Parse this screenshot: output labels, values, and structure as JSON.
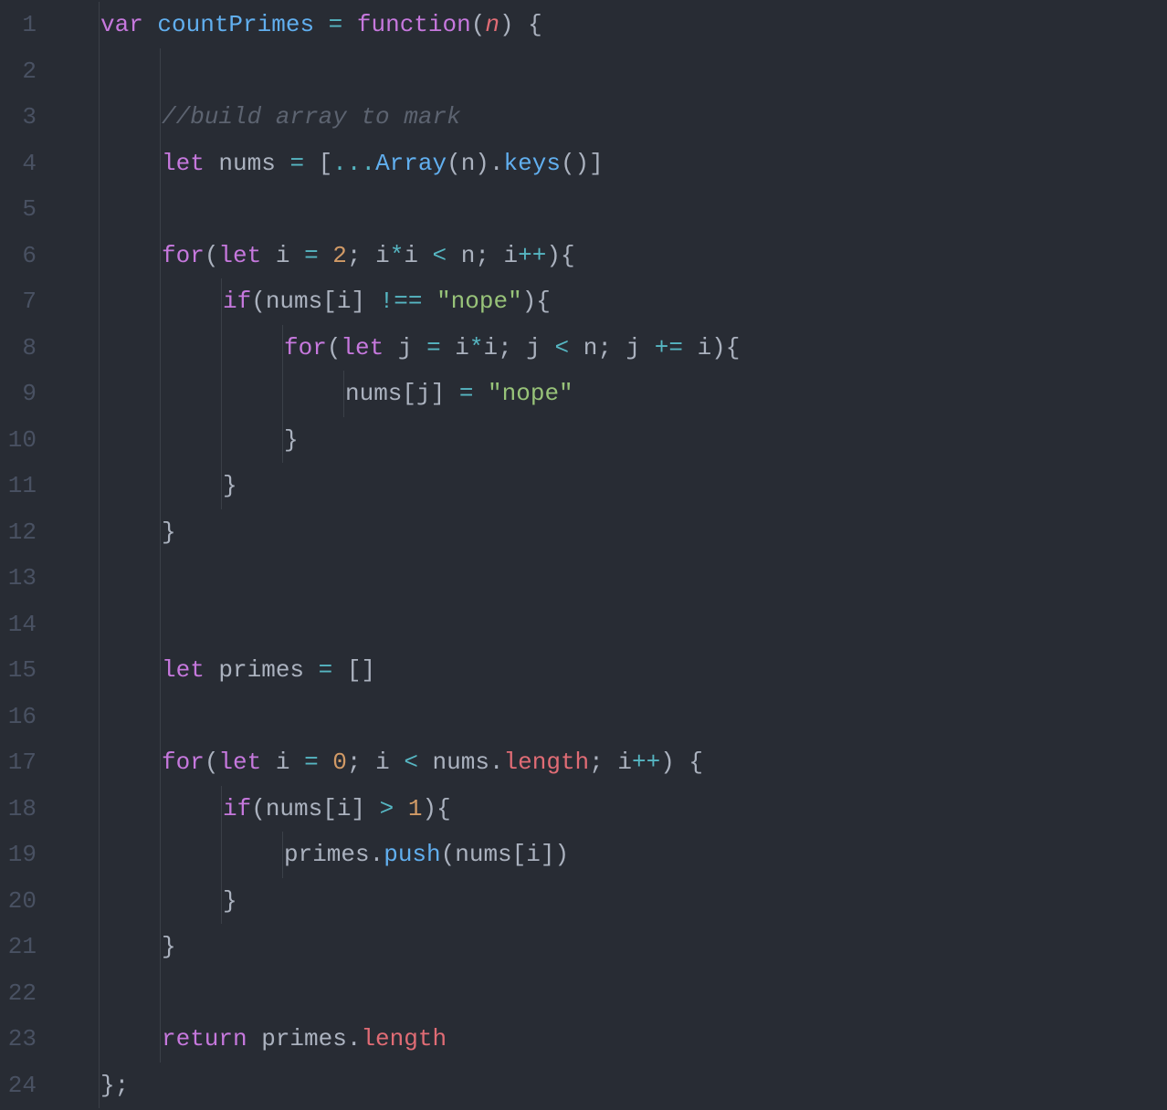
{
  "editor": {
    "language": "javascript",
    "line_count": 24,
    "lines": [
      {
        "num": 1,
        "indent": 1,
        "tokens": [
          {
            "t": "var ",
            "c": "kw"
          },
          {
            "t": "countPrimes",
            "c": "fn"
          },
          {
            "t": " ",
            "c": "pun"
          },
          {
            "t": "=",
            "c": "op"
          },
          {
            "t": " ",
            "c": "pun"
          },
          {
            "t": "function",
            "c": "kw"
          },
          {
            "t": "(",
            "c": "pun"
          },
          {
            "t": "n",
            "c": "param"
          },
          {
            "t": ") {",
            "c": "pun"
          }
        ]
      },
      {
        "num": 2,
        "indent": 2,
        "tokens": []
      },
      {
        "num": 3,
        "indent": 2,
        "tokens": [
          {
            "t": "//build array to mark",
            "c": "com"
          }
        ]
      },
      {
        "num": 4,
        "indent": 2,
        "tokens": [
          {
            "t": "let ",
            "c": "kw"
          },
          {
            "t": "nums ",
            "c": "id"
          },
          {
            "t": "=",
            "c": "op"
          },
          {
            "t": " [",
            "c": "pun"
          },
          {
            "t": "...",
            "c": "op"
          },
          {
            "t": "Array",
            "c": "fn"
          },
          {
            "t": "(n).",
            "c": "pun"
          },
          {
            "t": "keys",
            "c": "fn"
          },
          {
            "t": "()]",
            "c": "pun"
          }
        ]
      },
      {
        "num": 5,
        "indent": 2,
        "tokens": []
      },
      {
        "num": 6,
        "indent": 2,
        "tokens": [
          {
            "t": "for",
            "c": "kw"
          },
          {
            "t": "(",
            "c": "pun"
          },
          {
            "t": "let ",
            "c": "kw"
          },
          {
            "t": "i ",
            "c": "id"
          },
          {
            "t": "=",
            "c": "op"
          },
          {
            "t": " ",
            "c": "pun"
          },
          {
            "t": "2",
            "c": "num"
          },
          {
            "t": "; i",
            "c": "pun"
          },
          {
            "t": "*",
            "c": "op"
          },
          {
            "t": "i ",
            "c": "pun"
          },
          {
            "t": "<",
            "c": "op"
          },
          {
            "t": " n; i",
            "c": "pun"
          },
          {
            "t": "++",
            "c": "op"
          },
          {
            "t": "){",
            "c": "pun"
          }
        ]
      },
      {
        "num": 7,
        "indent": 3,
        "tokens": [
          {
            "t": "if",
            "c": "kw"
          },
          {
            "t": "(nums[i] ",
            "c": "pun"
          },
          {
            "t": "!==",
            "c": "op"
          },
          {
            "t": " ",
            "c": "pun"
          },
          {
            "t": "\"nope\"",
            "c": "str"
          },
          {
            "t": "){",
            "c": "pun"
          }
        ]
      },
      {
        "num": 8,
        "indent": 4,
        "tokens": [
          {
            "t": "for",
            "c": "kw"
          },
          {
            "t": "(",
            "c": "pun"
          },
          {
            "t": "let ",
            "c": "kw"
          },
          {
            "t": "j ",
            "c": "id"
          },
          {
            "t": "=",
            "c": "op"
          },
          {
            "t": " i",
            "c": "pun"
          },
          {
            "t": "*",
            "c": "op"
          },
          {
            "t": "i; j ",
            "c": "pun"
          },
          {
            "t": "<",
            "c": "op"
          },
          {
            "t": " n; j ",
            "c": "pun"
          },
          {
            "t": "+=",
            "c": "op"
          },
          {
            "t": " i){",
            "c": "pun"
          }
        ]
      },
      {
        "num": 9,
        "indent": 5,
        "tokens": [
          {
            "t": "nums[j] ",
            "c": "pun"
          },
          {
            "t": "=",
            "c": "op"
          },
          {
            "t": " ",
            "c": "pun"
          },
          {
            "t": "\"nope\"",
            "c": "str"
          }
        ]
      },
      {
        "num": 10,
        "indent": 4,
        "tokens": [
          {
            "t": "}",
            "c": "pun"
          }
        ]
      },
      {
        "num": 11,
        "indent": 3,
        "tokens": [
          {
            "t": "}",
            "c": "pun"
          }
        ]
      },
      {
        "num": 12,
        "indent": 2,
        "tokens": [
          {
            "t": "}",
            "c": "pun"
          }
        ]
      },
      {
        "num": 13,
        "indent": 2,
        "tokens": []
      },
      {
        "num": 14,
        "indent": 2,
        "tokens": []
      },
      {
        "num": 15,
        "indent": 2,
        "tokens": [
          {
            "t": "let ",
            "c": "kw"
          },
          {
            "t": "primes ",
            "c": "id"
          },
          {
            "t": "=",
            "c": "op"
          },
          {
            "t": " []",
            "c": "pun"
          }
        ]
      },
      {
        "num": 16,
        "indent": 2,
        "tokens": []
      },
      {
        "num": 17,
        "indent": 2,
        "tokens": [
          {
            "t": "for",
            "c": "kw"
          },
          {
            "t": "(",
            "c": "pun"
          },
          {
            "t": "let ",
            "c": "kw"
          },
          {
            "t": "i ",
            "c": "id"
          },
          {
            "t": "=",
            "c": "op"
          },
          {
            "t": " ",
            "c": "pun"
          },
          {
            "t": "0",
            "c": "num"
          },
          {
            "t": "; i ",
            "c": "pun"
          },
          {
            "t": "<",
            "c": "op"
          },
          {
            "t": " nums.",
            "c": "pun"
          },
          {
            "t": "length",
            "c": "prop"
          },
          {
            "t": "; i",
            "c": "pun"
          },
          {
            "t": "++",
            "c": "op"
          },
          {
            "t": ") {",
            "c": "pun"
          }
        ]
      },
      {
        "num": 18,
        "indent": 3,
        "tokens": [
          {
            "t": "if",
            "c": "kw"
          },
          {
            "t": "(nums[i] ",
            "c": "pun"
          },
          {
            "t": ">",
            "c": "op"
          },
          {
            "t": " ",
            "c": "pun"
          },
          {
            "t": "1",
            "c": "num"
          },
          {
            "t": "){",
            "c": "pun"
          }
        ]
      },
      {
        "num": 19,
        "indent": 4,
        "tokens": [
          {
            "t": "primes.",
            "c": "pun"
          },
          {
            "t": "push",
            "c": "fn"
          },
          {
            "t": "(nums[i])",
            "c": "pun"
          }
        ]
      },
      {
        "num": 20,
        "indent": 3,
        "tokens": [
          {
            "t": "}",
            "c": "pun"
          }
        ]
      },
      {
        "num": 21,
        "indent": 2,
        "tokens": [
          {
            "t": "}",
            "c": "pun"
          }
        ]
      },
      {
        "num": 22,
        "indent": 2,
        "tokens": []
      },
      {
        "num": 23,
        "indent": 2,
        "tokens": [
          {
            "t": "return ",
            "c": "kw"
          },
          {
            "t": "primes.",
            "c": "pun"
          },
          {
            "t": "length",
            "c": "prop"
          }
        ]
      },
      {
        "num": 24,
        "indent": 1,
        "tokens": [
          {
            "t": "};",
            "c": "pun"
          }
        ]
      }
    ]
  }
}
